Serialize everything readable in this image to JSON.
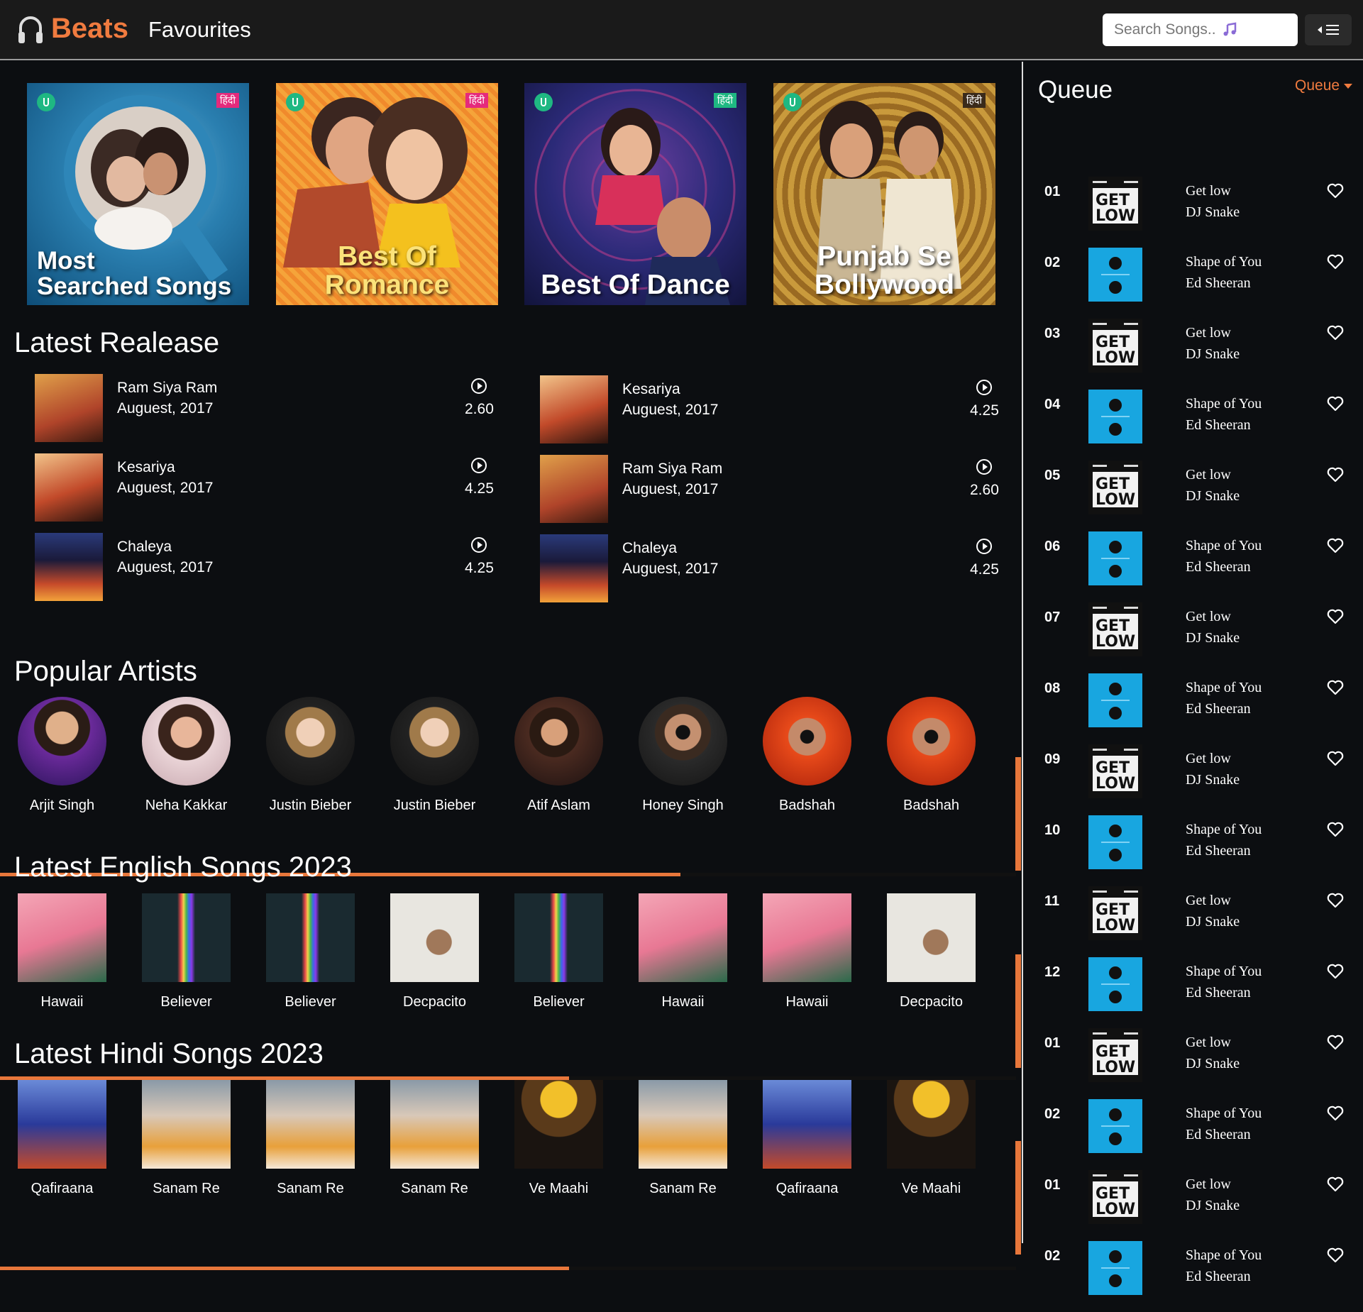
{
  "nav": {
    "brand": "Beats",
    "favourites": "Favourites",
    "search_placeholder": "Search Songs.."
  },
  "banners": [
    {
      "title": "Most\nSearched Songs",
      "badge": "हिंदी"
    },
    {
      "title": "Best Of\nRomance",
      "badge": "हिंदी"
    },
    {
      "title": "Best Of Dance",
      "badge": "हिंदी"
    },
    {
      "title": "Punjab Se\nBollywood",
      "badge": "हिंदी"
    }
  ],
  "latest_release": {
    "title": "Latest Realease",
    "items": [
      {
        "name": "Ram Siya Ram",
        "date": "Auguest, 2017",
        "duration": "2.60"
      },
      {
        "name": "Kesariya",
        "date": "Auguest, 2017",
        "duration": "4.25"
      },
      {
        "name": "Kesariya",
        "date": "Auguest, 2017",
        "duration": "4.25"
      },
      {
        "name": "Ram Siya Ram",
        "date": "Auguest, 2017",
        "duration": "2.60"
      },
      {
        "name": "Chaleya",
        "date": "Auguest, 2017",
        "duration": "4.25"
      },
      {
        "name": "Chaleya",
        "date": "Auguest, 2017",
        "duration": "4.25"
      }
    ]
  },
  "artists": {
    "title": "Popular Artists",
    "items": [
      "Arjit Singh",
      "Neha Kakkar",
      "Justin Bieber",
      "Justin Bieber",
      "Atif Aslam",
      "Honey Singh",
      "Badshah",
      "Badshah"
    ],
    "scroll": 0.67
  },
  "english": {
    "title": "Latest English Songs 2023",
    "items": [
      "Hawaii",
      "Believer",
      "Believer",
      "Decpacito",
      "Believer",
      "Hawaii",
      "Hawaii",
      "Decpacito"
    ],
    "scroll": 0.56
  },
  "hindi": {
    "title": "Latest Hindi Songs 2023",
    "items": [
      "Qafiraana",
      "Sanam Re",
      "Sanam Re",
      "Sanam Re",
      "Ve Maahi",
      "Sanam Re",
      "Qafiraana",
      "Ve Maahi"
    ],
    "scroll": 0.56
  },
  "queue": {
    "title": "Queue",
    "menu_label": "Queue",
    "items": [
      {
        "num": "01",
        "title": "Get low",
        "artist": "DJ Snake"
      },
      {
        "num": "02",
        "title": "Shape of You",
        "artist": "Ed Sheeran"
      },
      {
        "num": "03",
        "title": "Get low",
        "artist": "DJ Snake"
      },
      {
        "num": "04",
        "title": "Shape of You",
        "artist": "Ed Sheeran"
      },
      {
        "num": "05",
        "title": "Get low",
        "artist": "DJ Snake"
      },
      {
        "num": "06",
        "title": "Shape of You",
        "artist": "Ed Sheeran"
      },
      {
        "num": "07",
        "title": "Get low",
        "artist": "DJ Snake"
      },
      {
        "num": "08",
        "title": "Shape of You",
        "artist": "Ed Sheeran"
      },
      {
        "num": "09",
        "title": "Get low",
        "artist": "DJ Snake"
      },
      {
        "num": "10",
        "title": "Shape of You",
        "artist": "Ed Sheeran"
      },
      {
        "num": "11",
        "title": "Get low",
        "artist": "DJ Snake"
      },
      {
        "num": "12",
        "title": "Shape of You",
        "artist": "Ed Sheeran"
      },
      {
        "num": "01",
        "title": "Get low",
        "artist": "DJ Snake"
      },
      {
        "num": "02",
        "title": "Shape of You",
        "artist": "Ed Sheeran"
      },
      {
        "num": "01",
        "title": "Get low",
        "artist": "DJ Snake"
      },
      {
        "num": "02",
        "title": "Shape of You",
        "artist": "Ed Sheeran"
      }
    ]
  },
  "colors": {
    "accent": "#f07b3f",
    "background": "#0c0e11",
    "navbar": "#1a1a1a"
  }
}
